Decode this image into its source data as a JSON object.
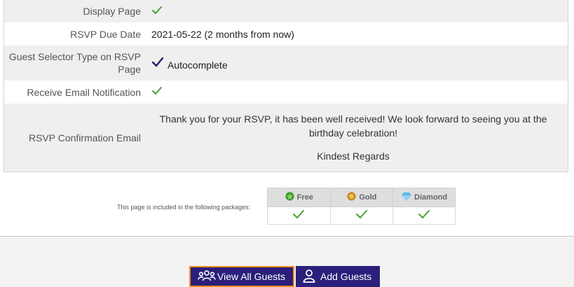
{
  "details": {
    "rows": [
      {
        "label": "Display Page",
        "value_type": "check"
      },
      {
        "label": "RSVP Due Date",
        "value": "2021-05-22 (2 months from now)"
      },
      {
        "label": "Guest Selector Type on RSVP Page",
        "value": "Autocomplete",
        "value_icon": "check-icon"
      },
      {
        "label": "Receive Email Notification",
        "value_type": "check"
      },
      {
        "label": "RSVP Confirmation Email",
        "message_line": "Thank you for your RSVP, it has been well received! We look forward to seeing you at the birthday celebration!",
        "signoff": "Kindest Regards"
      }
    ]
  },
  "packages": {
    "caption": "This page is included in the following packages:",
    "headers": [
      {
        "name": "Free",
        "icon": "leaf-badge-icon",
        "color": "#3a9a2e"
      },
      {
        "name": "Gold",
        "icon": "gold-badge-icon",
        "color": "#c98a1b"
      },
      {
        "name": "Diamond",
        "icon": "diamond-icon",
        "color": "#5ab4e8"
      }
    ],
    "included": [
      true,
      true,
      true
    ]
  },
  "buttons": {
    "view_all": "View All Guests",
    "add": "Add Guests"
  },
  "colors": {
    "check_green": "#4aa02c",
    "check_navy": "#1f1f6e",
    "button_bg": "#2a1f7a",
    "button_focus": "#f08a1d"
  }
}
